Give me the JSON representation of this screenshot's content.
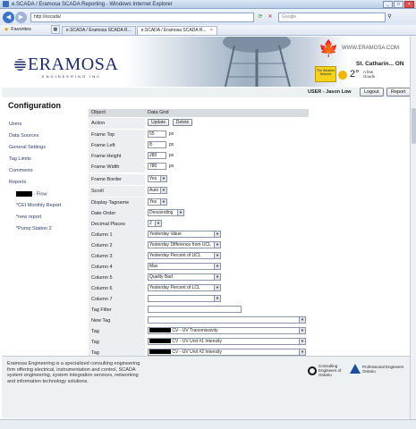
{
  "window": {
    "title": "e.SCADA / Eramosa SCADA Reporting - Windows Internet Explorer"
  },
  "browser": {
    "address": "http://escada/",
    "search_placeholder": "Google",
    "favorites_label": "Favorites",
    "tabs": [
      {
        "label": "e.SCADA / Eramosa SCADA R..."
      },
      {
        "label": "e.SCADA / Eramosa SCADA R..."
      }
    ]
  },
  "header": {
    "logo_word": "ERAMOSA",
    "logo_sub": "ENGINEERING INC",
    "url_text": "WWW.ERAMOSA.COM",
    "weather": {
      "badge": "The Weather Network",
      "city": "St. Catharin... ON",
      "temp": "2°",
      "cond_line1": "A few",
      "cond_line2": "clouds"
    },
    "user_label": "USER - Jason Low",
    "logout_label": "Logout",
    "report_label": "Report"
  },
  "sidebar": {
    "title": "Configuration",
    "items": [
      {
        "label": "Users"
      },
      {
        "label": "Data Sources"
      },
      {
        "label": "General Settings"
      },
      {
        "label": "Tag Limits"
      },
      {
        "label": "Comments"
      },
      {
        "label": "Reports"
      }
    ],
    "reports": [
      {
        "label": " - Flow"
      },
      {
        "label": "*CEI Monthly Report"
      },
      {
        "label": "*new report"
      },
      {
        "label": "*Pump Station 2"
      }
    ]
  },
  "grid": {
    "col_object": "Object",
    "col_datagrid": "Data Grid",
    "action_label": "Action",
    "update_label": "Update",
    "delete_label": "Delete",
    "rows": [
      {
        "label": "Frame Top",
        "value": "55",
        "unit": "px"
      },
      {
        "label": "Frame Left",
        "value": "8",
        "unit": "px"
      },
      {
        "label": "Frame Height",
        "value": "280",
        "unit": "px"
      },
      {
        "label": "Frame Width",
        "value": "780",
        "unit": "px"
      }
    ],
    "selects": [
      {
        "label": "Frame Border",
        "value": "Yes"
      },
      {
        "label": "Scroll",
        "value": "Auto"
      },
      {
        "label": "Display Tagname",
        "value": "Yes"
      },
      {
        "label": "Date Order",
        "value": "Descending"
      },
      {
        "label": "Decimal Places",
        "value": "2"
      }
    ],
    "columns": [
      {
        "label": "Column 1",
        "value": "Yesterday Value"
      },
      {
        "label": "Column 2",
        "value": "Yesterday Difference from UCL"
      },
      {
        "label": "Column 3",
        "value": "Yesterday Percent of UCL"
      },
      {
        "label": "Column 4",
        "value": "Max"
      },
      {
        "label": "Column 5",
        "value": "Quality Bad"
      },
      {
        "label": "Column 6",
        "value": "Yesterday Percent of LCL"
      },
      {
        "label": "Column 7",
        "value": ""
      }
    ],
    "tag_filter_label": "Tag Filter",
    "new_tag_label": "New Tag",
    "tags": [
      {
        "label": "Tag",
        "value": "CV - UV Transmissivity"
      },
      {
        "label": "Tag",
        "value": "CV - UV Unit #1 Intensity"
      },
      {
        "label": "Tag",
        "value": "CV - UV Unit #2 Intensity"
      }
    ]
  },
  "footer": {
    "text": "Eramosa Engineering is a specialized consulting engineering firm offering electrical, instrumentation and control, SCADA system engineering, system integration services, networking and information technology solutions.",
    "ceo": "Consulting Engineers of Ontario",
    "pe_line1": "Professional Engineers",
    "pe_line2": "Ontario"
  }
}
